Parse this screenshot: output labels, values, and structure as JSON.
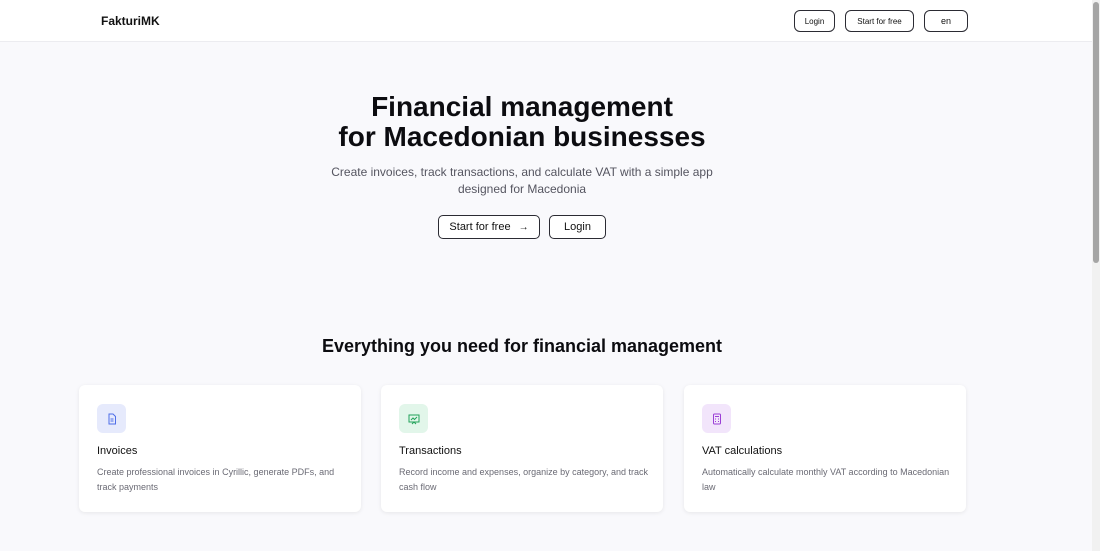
{
  "header": {
    "logo": "FakturiMK",
    "login_label": "Login",
    "start_label": "Start for free",
    "lang_label": "en"
  },
  "hero": {
    "title_line1": "Financial management",
    "title_line2": "for Macedonian businesses",
    "subtitle": "Create invoices, track transactions, and calculate VAT with a simple app designed for Macedonia",
    "start_label": "Start for free",
    "arrow": "→",
    "login_label": "Login"
  },
  "features": {
    "title": "Everything you need for financial management",
    "items": [
      {
        "icon": "document-icon",
        "title": "Invoices",
        "description": "Create professional invoices in Cyrillic, generate PDFs, and track payments",
        "color": "#4f6ee8",
        "bg": "#e6eafc"
      },
      {
        "icon": "chart-icon",
        "title": "Transactions",
        "description": "Record income and expenses, organize by category, and track cash flow",
        "color": "#22a25a",
        "bg": "#e2f6ea"
      },
      {
        "icon": "calculator-icon",
        "title": "VAT calculations",
        "description": "Automatically calculate monthly VAT according to Macedonian law",
        "color": "#9b3fd6",
        "bg": "#f2e5fb"
      }
    ]
  }
}
